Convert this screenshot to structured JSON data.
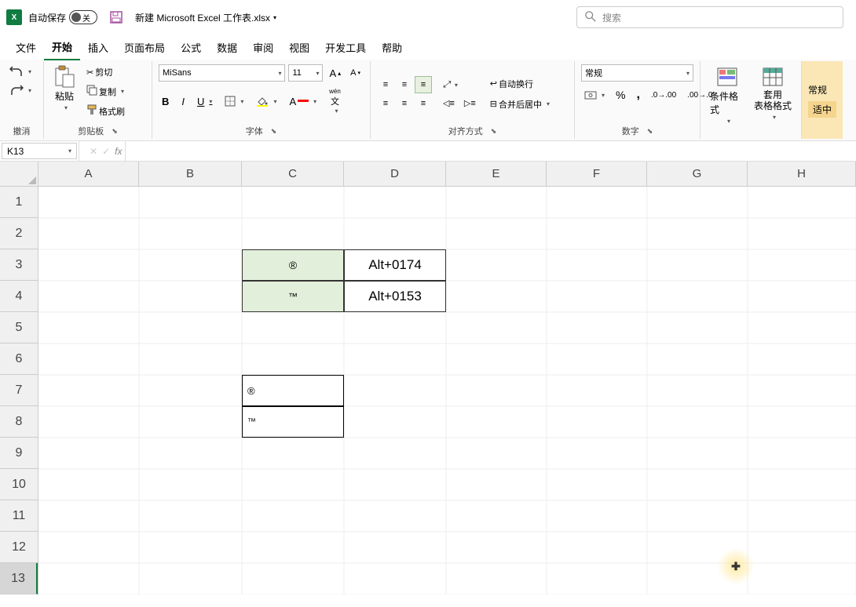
{
  "titlebar": {
    "autosave_label": "自动保存",
    "autosave_state": "关",
    "filename": "新建 Microsoft Excel 工作表.xlsx",
    "search_placeholder": "搜索"
  },
  "menu": {
    "items": [
      "文件",
      "开始",
      "插入",
      "页面布局",
      "公式",
      "数据",
      "审阅",
      "视图",
      "开发工具",
      "帮助"
    ],
    "active": "开始"
  },
  "ribbon": {
    "undo_group": "撤消",
    "clipboard": {
      "paste": "粘贴",
      "cut": "剪切",
      "copy": "复制",
      "format_painter": "格式刷",
      "label": "剪贴板"
    },
    "font": {
      "name": "MiSans",
      "size": "11",
      "wen_label": "wén",
      "char_label": "文",
      "label": "字体"
    },
    "alignment": {
      "wrap": "自动换行",
      "merge": "合并后居中",
      "label": "对齐方式"
    },
    "number": {
      "format": "常规",
      "label": "数字"
    },
    "styles": {
      "cond": "条件格式",
      "table": "套用\n表格格式"
    },
    "last": {
      "normal": "常规",
      "good": "适中"
    }
  },
  "namebox": "K13",
  "columns": [
    "A",
    "B",
    "C",
    "D",
    "E",
    "F",
    "G",
    "H"
  ],
  "rows": [
    "1",
    "2",
    "3",
    "4",
    "5",
    "6",
    "7",
    "8",
    "9",
    "10",
    "11",
    "12",
    "13"
  ],
  "active_row": "13",
  "cells": {
    "C3": "®",
    "D3": "Alt+0174",
    "C4": "™",
    "D4": "Alt+0153",
    "C7": "®",
    "C8": "™"
  }
}
